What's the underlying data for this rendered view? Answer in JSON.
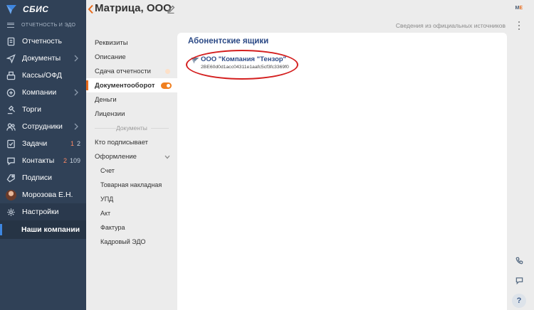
{
  "app": {
    "logo_text": "СБИС",
    "menu_label": "ОТЧЕТНОСТЬ И ЭДО"
  },
  "nav": [
    {
      "label": "Отчетность",
      "icon": "report-icon"
    },
    {
      "label": "Документы",
      "icon": "send-icon",
      "chevron": true
    },
    {
      "label": "Кассы/ОФД",
      "icon": "cashbox-icon"
    },
    {
      "label": "Компании",
      "icon": "company-icon",
      "chevron": true
    },
    {
      "label": "Торги",
      "icon": "auction-icon"
    },
    {
      "label": "Сотрудники",
      "icon": "employees-icon",
      "chevron": true
    },
    {
      "label": "Задачи",
      "icon": "tasks-icon",
      "badge_red": "1",
      "badge_gray": "2"
    },
    {
      "label": "Контакты",
      "icon": "contacts-icon",
      "badge_red": "2",
      "badge_gray": "109"
    },
    {
      "label": "Подписи",
      "icon": "signature-icon"
    },
    {
      "label": "Морозова Е.Н.",
      "icon": "avatar"
    },
    {
      "label": "Настройки",
      "icon": "settings-icon"
    }
  ],
  "nav_sub": {
    "label": "Наши компании"
  },
  "header": {
    "title": "Матрица, ООО",
    "me_prefix": "M",
    "me_suffix": "E",
    "source_link": "Сведения из официальных источников"
  },
  "sections": {
    "items": [
      {
        "label": "Реквизиты"
      },
      {
        "label": "Описание"
      },
      {
        "label": "Сдача отчетности"
      },
      {
        "label": "Документооборот"
      },
      {
        "label": "Деньги"
      },
      {
        "label": "Лицензии"
      }
    ],
    "docs_heading": "Документы",
    "docs_items": [
      {
        "label": "Кто подписывает"
      },
      {
        "label": "Оформление"
      }
    ],
    "doc_types": [
      "Счет",
      "Товарная накладная",
      "УПД",
      "Акт",
      "Фактура",
      "Кадровый ЭДО"
    ]
  },
  "card": {
    "title": "Абонентские ящики",
    "mailbox": {
      "name": "ООО \"Компания \"Тензор\"",
      "id": "2BE60d0d1acc04311e1aafc5cf3fc3369f0"
    }
  },
  "tools": {
    "help_label": "?"
  },
  "colors": {
    "sidebar": "#304157",
    "accent": "#e86a1a",
    "link": "#2c4a86",
    "highlight": "#d41f1f"
  }
}
